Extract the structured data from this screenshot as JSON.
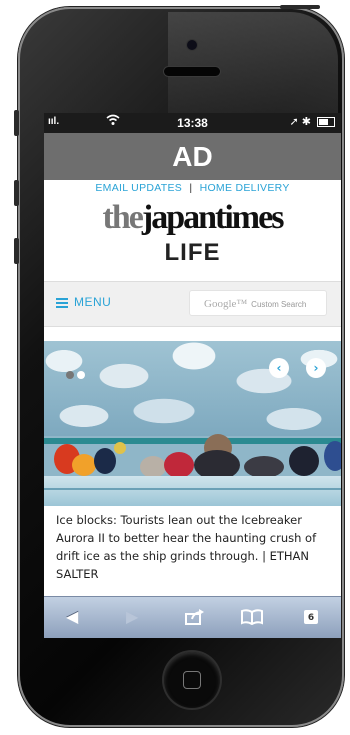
{
  "status_bar": {
    "signal": "ııl.",
    "time": "13:38",
    "right_icons": "➚ ✱"
  },
  "ad_banner": {
    "label": "AD"
  },
  "top_links": {
    "email_updates": "EMAIL UPDATES",
    "separator": "|",
    "home_delivery": "HOME DELIVERY"
  },
  "masthead": {
    "the": "the",
    "name": "japantimes",
    "section": "LIFE"
  },
  "nav": {
    "menu_label": "MENU",
    "search_brand": "Google™",
    "search_placeholder": "Custom Search"
  },
  "slider": {
    "prev_icon": "‹",
    "next_icon": "›",
    "dots_total": 2,
    "active_dot": 2
  },
  "article": {
    "caption": "Ice blocks: Tourists lean out the Icebreaker Aurora II to better hear the haunting crush of drift ice as the ship grinds through. | ETHAN SALTER"
  },
  "browser_toolbar": {
    "back_icon": "◀",
    "forward_icon": "▶",
    "share_icon": "share-icon",
    "bookmarks_icon": "book-icon",
    "tabs_count": "6"
  }
}
